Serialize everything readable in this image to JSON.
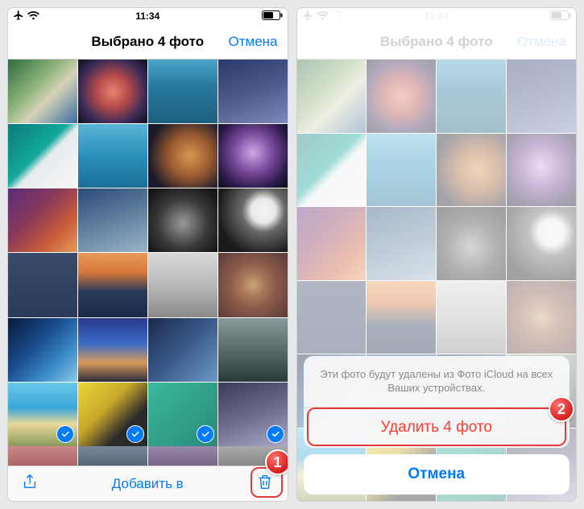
{
  "status": {
    "time": "11:34"
  },
  "nav": {
    "title": "Выбрано 4 фото",
    "cancel": "Отмена"
  },
  "toolbar": {
    "add_to": "Добавить в"
  },
  "sheet": {
    "message": "Эти фото будут удалены из Фото iCloud на всех Ваших устройствах.",
    "delete": "Удалить 4 фото",
    "cancel": "Отмена"
  },
  "badges": {
    "one": "1",
    "two": "2"
  },
  "thumbs": [
    {
      "bg": "linear-gradient(135deg,#2e6b3f 0%,#8fb37a 40%,#d6d3b8 60%,#3a6ea0 100%)"
    },
    {
      "bg": "radial-gradient(circle at 50% 50%,#e8836f 0%,#b34a4a 35%,#3a2a58 70%,#0f0f1a 100%)"
    },
    {
      "bg": "linear-gradient(180deg,#4aa3c7 0%,#2a7a9f 40%,#1a5f7f 100%)"
    },
    {
      "bg": "linear-gradient(160deg,#2a3a6a 0%,#4a5a8a 50%,#7a8aba 100%)"
    },
    {
      "bg": "linear-gradient(135deg,#0d7a7a 0%,#12a89a 45%,#e8ecef 55%,#f5f5f5 100%)"
    },
    {
      "bg": "linear-gradient(180deg,#5ab5d8 0%,#2a8fb8 50%,#1a6f98 100%)"
    },
    {
      "bg": "radial-gradient(circle at 60% 50%,#d89850 0%,#9a5a30 40%,#1a1a2a 80%)"
    },
    {
      "bg": "radial-gradient(circle at 50% 45%,#cfa8e8 0%,#7a4a9a 40%,#2a1a4a 75%,#0a0a1a 100%)"
    },
    {
      "bg": "linear-gradient(135deg,#5a2a7a 0%,#8a3a5a 40%,#c85a3a 70%,#e89a5a 100%)"
    },
    {
      "bg": "linear-gradient(160deg,#2a4a7a 0%,#5a7a9a 45%,#9ab5c8 100%)"
    },
    {
      "bg": "radial-gradient(circle at 50% 55%,#9a9a9a 0%,#3a3a3a 50%,#0a0a0a 100%)"
    },
    {
      "bg": "radial-gradient(circle at 65% 35%,#f5f5f5 0%,#e8e8e8 20%,#6a6a6a 35%,#1a1a1a 75%)"
    },
    {
      "bg": "linear-gradient(180deg,#3a4a6a 0%,#2a3a5a 100%)"
    },
    {
      "bg": "linear-gradient(180deg,#e89a5a 0%,#d87a3a 30%,#2a3a5a 60%,#1a2a4a 100%)"
    },
    {
      "bg": "linear-gradient(180deg,#d8d8d8 0%,#b8b8b8 50%,#8a8a8a 100%)"
    },
    {
      "bg": "radial-gradient(circle,#c8a878 0%,#a8785a 25%,#8a5a4a 50%,#5a3a3a 100%)"
    },
    {
      "bg": "linear-gradient(135deg,#0a1a3a 0%,#1a4a8a 40%,#3a8ac8 70%,#8ac8e8 100%)"
    },
    {
      "bg": "linear-gradient(180deg,#2a3a8a 0%,#3a6ac8 40%,#d89a5a 70%,#2a2a3a 100%)"
    },
    {
      "bg": "linear-gradient(135deg,#1a2a4a 0%,#3a5a8a 50%,#6a9ac8 100%)"
    },
    {
      "bg": "linear-gradient(180deg,#8a9a9a 0%,#5a6a6a 50%,#2a3a3a 100%)"
    },
    {
      "bg": "linear-gradient(180deg,#6ac8e8 0%,#3aa8d8 40%,#e8d89a 65%,#8a9a5a 100%)"
    },
    {
      "bg": "linear-gradient(135deg,#e8d83a 0%,#c8a82a 40%,#2a2a2a 70%)"
    },
    {
      "bg": "linear-gradient(135deg,#3ab89a 0%,#2a8a7a 100%)"
    },
    {
      "bg": "linear-gradient(160deg,#3a3a5a 0%,#6a6a8a 50%,#a8a8c8 100%)"
    }
  ],
  "selected_indices": [
    20,
    21,
    22,
    23
  ]
}
